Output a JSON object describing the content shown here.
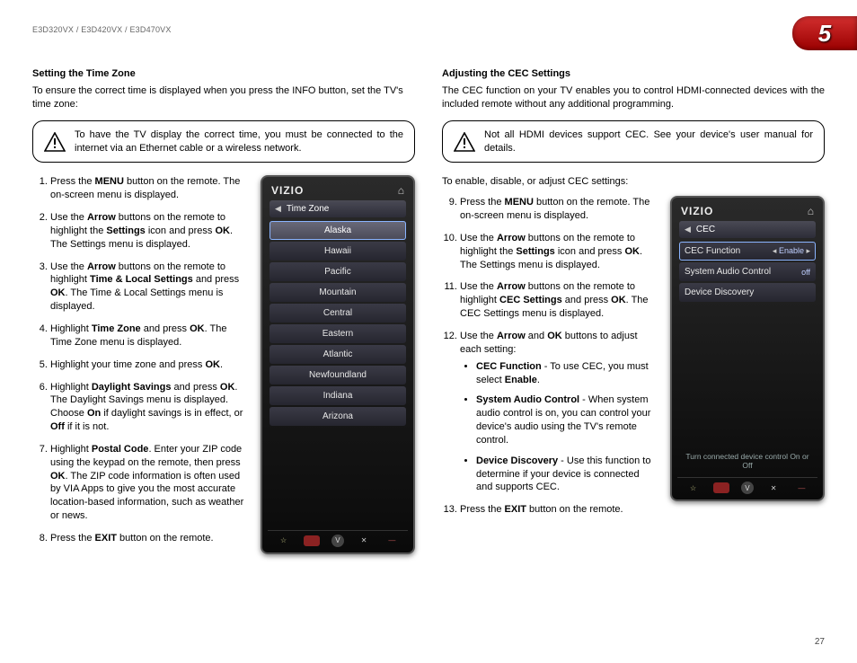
{
  "header": {
    "models": "E3D320VX / E3D420VX / E3D470VX",
    "chapter": "5"
  },
  "left": {
    "title": "Setting the Time Zone",
    "intro": "To ensure the correct time is displayed when you press the INFO button, set the TV's time zone:",
    "callout": "To have the TV display the correct time, you must be connected to the internet via an Ethernet cable or a wireless network.",
    "s1a": "Press the ",
    "s1b": "MENU",
    "s1c": " button on the remote. The on-screen menu is displayed.",
    "s2a": "Use the ",
    "s2b": "Arrow",
    "s2c": " buttons on the remote to highlight the ",
    "s2d": "Settings",
    "s2e": " icon and press ",
    "s2f": "OK",
    "s2g": ". The Settings menu is displayed.",
    "s3a": "Use the ",
    "s3b": "Arrow",
    "s3c": " buttons on the remote to highlight ",
    "s3d": "Time & Local Settings",
    "s3e": " and press ",
    "s3f": "OK",
    "s3g": ". The Time & Local Settings menu is displayed.",
    "s4a": "Highlight ",
    "s4b": "Time Zone",
    "s4c": " and press ",
    "s4d": "OK",
    "s4e": ". The Time Zone menu is displayed.",
    "s5a": "Highlight your time zone and press ",
    "s5b": "OK",
    "s5c": ".",
    "s6a": "Highlight ",
    "s6b": "Daylight Savings",
    "s6c": " and press ",
    "s6d": "OK",
    "s6e": ". The Daylight Savings menu is displayed. Choose ",
    "s6f": "On",
    "s6g": " if daylight savings is in effect, or ",
    "s6h": "Off",
    "s6i": " if it is not.",
    "s7a": "Highlight ",
    "s7b": "Postal Code",
    "s7c": ". Enter your ZIP code using the keypad on the remote, then press ",
    "s7d": "OK",
    "s7e": ". The ZIP code information is often used by VIA Apps to give you the most accurate location-based information, such as weather or news.",
    "s8a": "Press the ",
    "s8b": "EXIT",
    "s8c": " button on the remote.",
    "device": {
      "brand": "VIZIO",
      "breadcrumb": "Time Zone",
      "items": [
        "Alaska",
        "Hawaii",
        "Pacific",
        "Mountain",
        "Central",
        "Eastern",
        "Atlantic",
        "Newfoundland",
        "Indiana",
        "Arizona"
      ]
    }
  },
  "right": {
    "title": "Adjusting the CEC Settings",
    "intro": "The CEC function on your TV enables you to control HDMI-connected devices with the included remote without any additional programming.",
    "callout": "Not all HDMI devices support CEC. See your device's user manual for details.",
    "lead": "To enable, disable, or adjust CEC settings:",
    "s9a": "Press the ",
    "s9b": "MENU",
    "s9c": " button on the remote. The on-screen menu is displayed.",
    "s10a": "Use the ",
    "s10b": "Arrow",
    "s10c": " buttons on the remote to highlight the ",
    "s10d": "Settings",
    "s10e": " icon and press ",
    "s10f": "OK",
    "s10g": ". The Settings menu is displayed.",
    "s11a": "Use the ",
    "s11b": "Arrow",
    "s11c": " buttons on the remote to highlight ",
    "s11d": "CEC Settings",
    "s11e": " and press ",
    "s11f": "OK",
    "s11g": ". The CEC Settings menu is displayed.",
    "s12a": "Use the ",
    "s12b": "Arrow",
    "s12c": " and ",
    "s12d": "OK",
    "s12e": " buttons to adjust each setting:",
    "b1a": "CEC Function",
    "b1b": " - To use CEC, you must select ",
    "b1c": "Enable",
    "b1d": ".",
    "b2a": "System Audio Control",
    "b2b": " - When system audio control is on, you can control your device's audio using the TV's remote control.",
    "b3a": "Device Discovery",
    "b3b": " - Use this function to determine if your device is connected and supports CEC.",
    "s13a": "Press the ",
    "s13b": "EXIT",
    "s13c": " button on the remote.",
    "device": {
      "brand": "VIZIO",
      "breadcrumb": "CEC",
      "rows": [
        {
          "label": "CEC Function",
          "value": "Enable",
          "sel": true
        },
        {
          "label": "System Audio Control",
          "value": "off"
        },
        {
          "label": "Device Discovery",
          "value": ""
        }
      ],
      "hint": "Turn connected device control On or Off"
    }
  },
  "pagenum": "27"
}
